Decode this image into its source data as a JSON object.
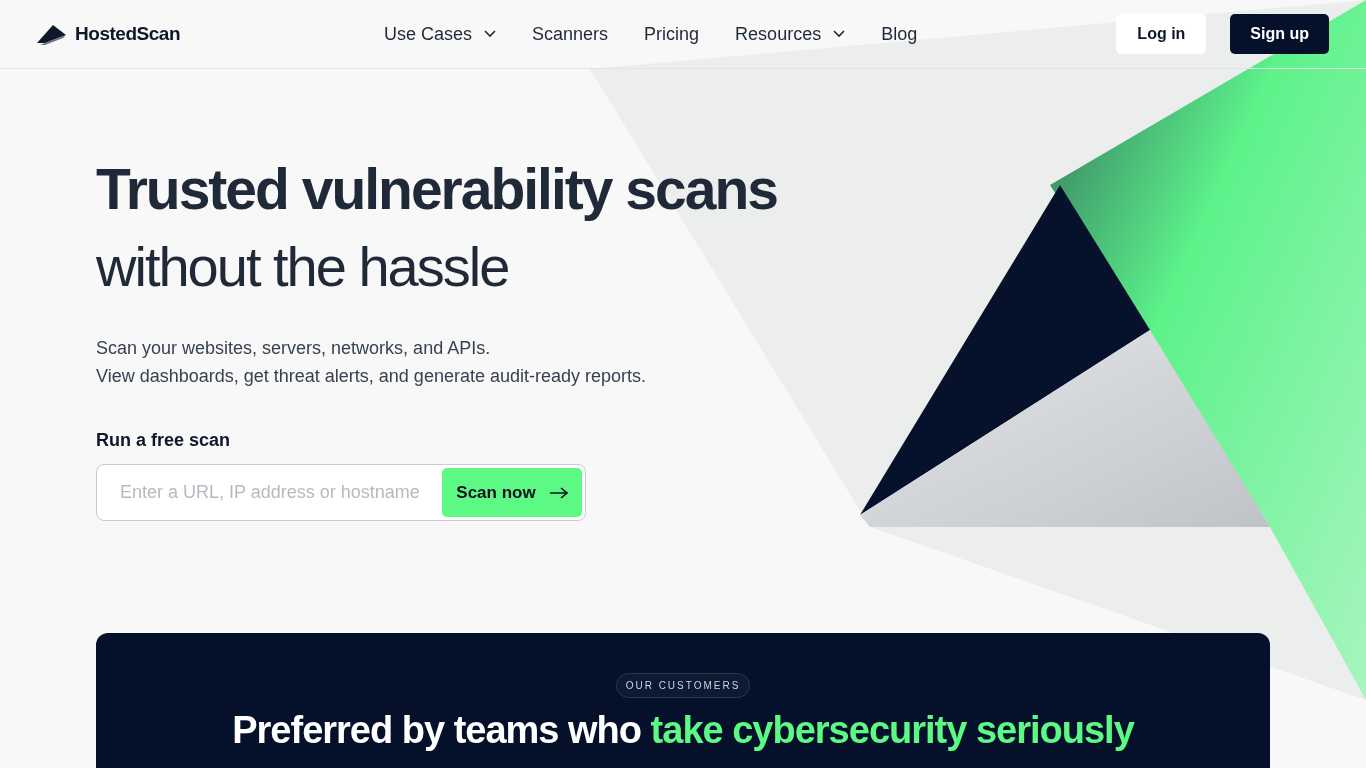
{
  "brand": {
    "name": "HostedScan"
  },
  "nav": [
    {
      "label": "Use Cases",
      "has_menu": true
    },
    {
      "label": "Scanners",
      "has_menu": false
    },
    {
      "label": "Pricing",
      "has_menu": false
    },
    {
      "label": "Resources",
      "has_menu": true
    },
    {
      "label": "Blog",
      "has_menu": false
    }
  ],
  "auth_buttons": [
    {
      "label": "Log in",
      "kind": "secondary"
    },
    {
      "label": "Sign up",
      "kind": "primary"
    }
  ],
  "hero": {
    "title_bold": "Trusted vulnerability scans",
    "title_light": "without the hassle",
    "description": [
      "Scan your websites, servers, networks, and APIs.",
      "View dashboards, get threat alerts, and generate audit-ready reports."
    ],
    "scan_label": "Run a free scan",
    "scan_field": {
      "placeholder": "Enter a URL, IP address or hostname"
    },
    "scan_button": "Scan now"
  },
  "customers": {
    "badge": "OUR CUSTOMERS",
    "heading_lead": "Preferred by teams who",
    "heading_highlight": "take cybersecurity seriously"
  }
}
